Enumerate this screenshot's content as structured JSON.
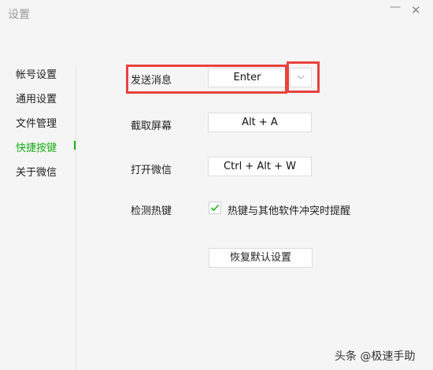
{
  "window": {
    "title": "设置",
    "minimize_glyph": "—",
    "close_glyph": "✕"
  },
  "sidebar": {
    "items": [
      {
        "label": "帐号设置"
      },
      {
        "label": "通用设置"
      },
      {
        "label": "文件管理"
      },
      {
        "label": "快捷按键",
        "active": true
      },
      {
        "label": "关于微信"
      }
    ]
  },
  "shortcuts": {
    "send_message": {
      "label": "发送消息",
      "value": "Enter"
    },
    "screenshot": {
      "label": "截取屏幕",
      "value": "Alt + A"
    },
    "open_wechat": {
      "label": "打开微信",
      "value": "Ctrl + Alt + W"
    },
    "detect_hotkey": {
      "label": "检测热键",
      "checkbox_label": "热键与其他软件冲突时提醒",
      "checked": true
    },
    "reset_label": "恢复默认设置"
  },
  "watermark": {
    "text": "头条 @极速手助"
  },
  "colors": {
    "accent": "#1aad19",
    "highlight": "#e8423f",
    "background": "#f5f5f5"
  }
}
